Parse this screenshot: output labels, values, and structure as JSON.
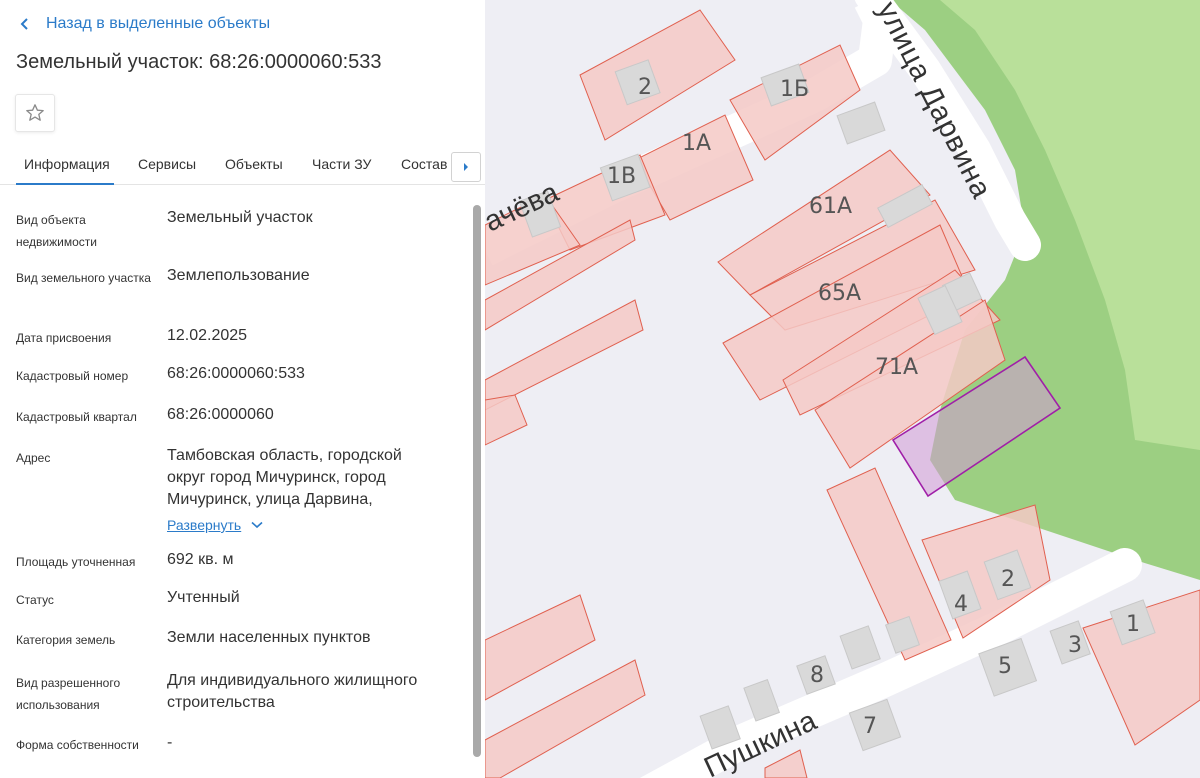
{
  "panel": {
    "back_label": "Назад в выделенные объекты",
    "title": "Земельный участок: 68:26:0000060:533",
    "tabs": [
      "Информация",
      "Сервисы",
      "Объекты",
      "Части ЗУ",
      "Состав"
    ],
    "active_tab": "Информация",
    "fields": [
      {
        "label": "Вид объекта недвижимости",
        "value": "Земельный участок"
      },
      {
        "label": "Вид земельного участка",
        "value": "Землепользование"
      },
      {
        "label": "Дата присвоения",
        "value": "12.02.2025"
      },
      {
        "label": "Кадастровый номер",
        "value": "68:26:0000060:533"
      },
      {
        "label": "Кадастровый квартал",
        "value": "68:26:0000060"
      },
      {
        "label": "Адрес",
        "value": "Тамбовская область, городской округ город Мичуринск, город Мичуринск, улица Дарвина,"
      },
      {
        "label": "Площадь уточненная",
        "value": "692 кв. м"
      },
      {
        "label": "Статус",
        "value": "Учтенный"
      },
      {
        "label": "Категория земель",
        "value": "Земли населенных пунктов"
      },
      {
        "label": "Вид разрешенного использования",
        "value": "Для индивидуального жилищного строительства"
      },
      {
        "label": "Форма собственности",
        "value": "-"
      }
    ],
    "expand_label": "Развернуть"
  },
  "map": {
    "streets": [
      "улица Дарвина",
      "ачёва",
      "Пушкина"
    ],
    "house_numbers": [
      "2",
      "1Б",
      "1А",
      "1В",
      "61А",
      "65А",
      "71А",
      "2",
      "4",
      "8",
      "5",
      "3",
      "1",
      "7"
    ],
    "colors": {
      "background": "#eeeef4",
      "green_area": "#b9e09a",
      "green_dark": "#9ccf82",
      "parcel_fill": "#f4c9c6",
      "parcel_stroke": "#e0604f",
      "selected_stroke": "#a01fa8",
      "selected_fill": "#d29ad6",
      "building": "#d9d9d9",
      "accent": "#2b7bc9"
    }
  }
}
